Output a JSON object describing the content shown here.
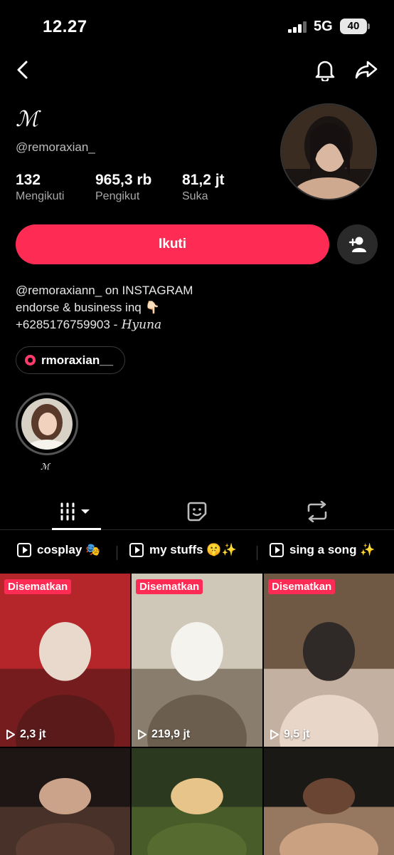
{
  "status": {
    "time": "12.27",
    "network": "5G",
    "battery": "40"
  },
  "profile": {
    "display_name": "ℳ",
    "handle": "@remoraxian_",
    "stats": [
      {
        "value": "132",
        "label": "Mengikuti"
      },
      {
        "value": "965,3 rb",
        "label": "Pengikut"
      },
      {
        "value": "81,2 jt",
        "label": "Suka"
      }
    ],
    "follow_label": "Ikuti",
    "bio_line1": "@remoraxiann_ on INSTAGRAM",
    "bio_line2": " endorse & business inq 👇🏻",
    "bio_line3_phone": "+6285176759903",
    "bio_line3_sig": "- 𝐻𝑦𝑢𝑛𝑎",
    "instagram_link": "rmoraxian__",
    "highlight_label": "ℳ"
  },
  "tabs": [
    {
      "name": "videos",
      "icon": "grid-icon"
    },
    {
      "name": "liked",
      "icon": "sticker-icon"
    },
    {
      "name": "reposts",
      "icon": "repost-icon"
    }
  ],
  "playlists": [
    {
      "label": "cosplay 🎭"
    },
    {
      "label": "my stuffs 🤫✨"
    },
    {
      "label": "sing a song ✨"
    }
  ],
  "videos": [
    {
      "pinned": "Disematkan",
      "views": "2,3 jt",
      "colors": [
        "#b5262a",
        "#5a1a1a",
        "#e9d9cc"
      ]
    },
    {
      "pinned": "Disematkan",
      "views": "219,9 jt",
      "colors": [
        "#cfc7b8",
        "#6b5e4e",
        "#f5f3ee"
      ]
    },
    {
      "pinned": "Disematkan",
      "views": "9,5 jt",
      "colors": [
        "#6f5844",
        "#e8d6c8",
        "#2f2a28"
      ]
    },
    {
      "pinned": "",
      "views": "",
      "colors": [
        "#1e1614",
        "#5a3d30",
        "#caa38a"
      ]
    },
    {
      "pinned": "",
      "views": "",
      "colors": [
        "#2b3a1e",
        "#556b2f",
        "#e7c48a"
      ]
    },
    {
      "pinned": "",
      "views": "",
      "colors": [
        "#1b1916",
        "#caa181",
        "#6a4534"
      ]
    }
  ],
  "colors": {
    "accent": "#fe2c55",
    "background": "#000000"
  }
}
